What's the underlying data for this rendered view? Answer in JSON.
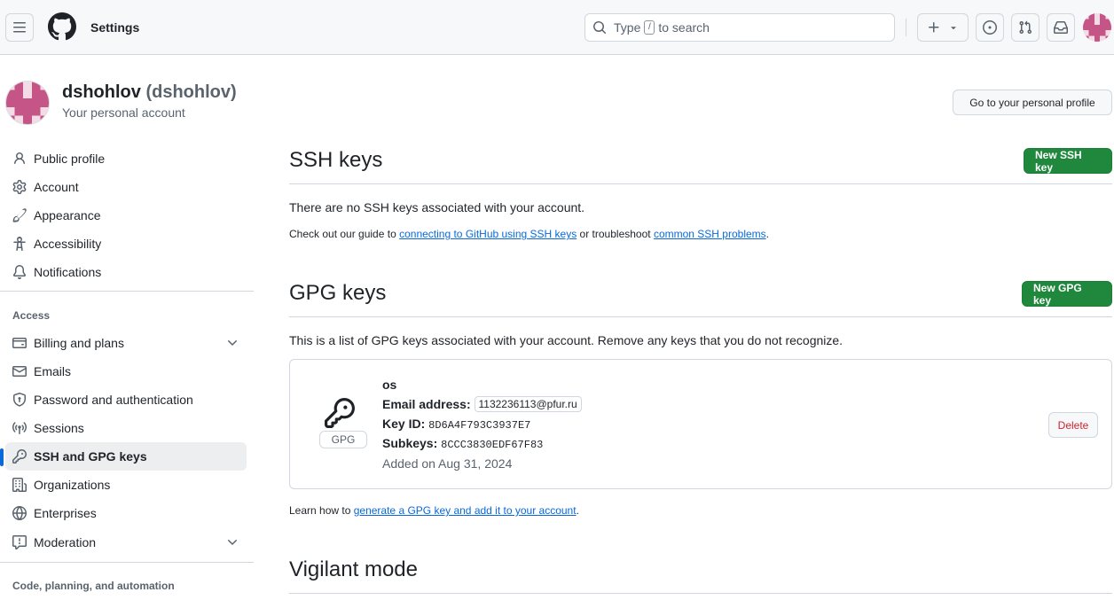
{
  "header": {
    "context_title": "Settings",
    "search_placeholder_prefix": "Type",
    "search_key": "/",
    "search_placeholder_suffix": "to search"
  },
  "profile": {
    "name": "dshohlov",
    "login": "(dshohlov)",
    "subtitle": "Your personal account",
    "go_profile_label": "Go to your personal profile"
  },
  "sidebar": {
    "items_top": [
      {
        "label": "Public profile",
        "icon": "person-icon"
      },
      {
        "label": "Account",
        "icon": "gear-icon"
      },
      {
        "label": "Appearance",
        "icon": "paintbrush-icon"
      },
      {
        "label": "Accessibility",
        "icon": "accessibility-icon"
      },
      {
        "label": "Notifications",
        "icon": "bell-icon"
      }
    ],
    "access_heading": "Access",
    "items_access": [
      {
        "label": "Billing and plans",
        "icon": "credit-card-icon"
      },
      {
        "label": "Emails",
        "icon": "mail-icon"
      },
      {
        "label": "Password and authentication",
        "icon": "shield-lock-icon"
      },
      {
        "label": "Sessions",
        "icon": "broadcast-icon"
      },
      {
        "label": "SSH and GPG keys",
        "icon": "key-icon"
      },
      {
        "label": "Organizations",
        "icon": "organization-icon"
      },
      {
        "label": "Enterprises",
        "icon": "globe-icon"
      },
      {
        "label": "Moderation",
        "icon": "report-icon"
      }
    ],
    "active_item": "SSH and GPG keys",
    "code_heading": "Code, planning, and automation"
  },
  "ssh": {
    "title": "SSH keys",
    "new_button": "New SSH key",
    "empty_text": "There are no SSH keys associated with your account.",
    "guide_prefix": "Check out our guide to",
    "guide_link": "connecting to GitHub using SSH keys",
    "guide_middle": "or troubleshoot",
    "guide_link2": "common SSH problems",
    "guide_suffix": "."
  },
  "gpg": {
    "title": "GPG keys",
    "new_button": "New GPG key",
    "description": "This is a list of GPG keys associated with your account. Remove any keys that you do not recognize.",
    "key": {
      "badge": "GPG",
      "name": "os",
      "email_label": "Email address:",
      "email": "1132236113@pfur.ru",
      "keyid_label": "Key ID:",
      "keyid": "8D6A4F793C3937E7",
      "subkeys_label": "Subkeys:",
      "subkeys": "8CCC3830EDF67F83",
      "added": "Added on Aug 31, 2024",
      "delete_label": "Delete"
    },
    "learn_prefix": "Learn how to",
    "learn_link": "generate a GPG key and add it to your account",
    "learn_suffix": "."
  },
  "vigilant": {
    "title": "Vigilant mode"
  },
  "colors": {
    "primary_green": "#1f883d",
    "link_blue": "#0969da",
    "danger_red": "#d1242f",
    "active_indicator": "#0969da"
  }
}
